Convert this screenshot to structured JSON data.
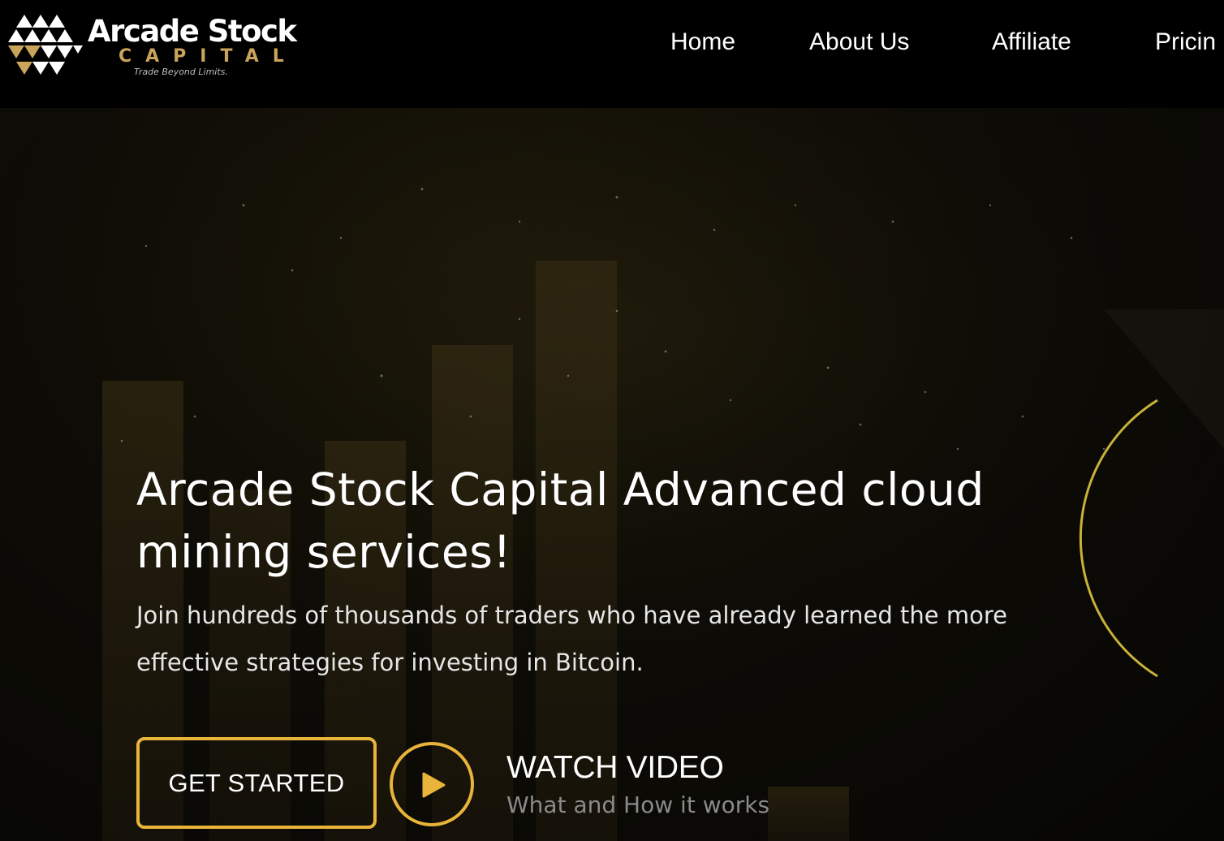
{
  "brand": {
    "name": "Arcade Stock",
    "sub": "CAPITAL",
    "tagline": "Trade Beyond Limits.",
    "accent_color": "#e8b43a",
    "logo_gold": "#c9a45a"
  },
  "nav": {
    "items": [
      {
        "label": "Home"
      },
      {
        "label": "About Us"
      },
      {
        "label": "Affiliate"
      },
      {
        "label": "Pricin"
      }
    ]
  },
  "hero": {
    "title": "Arcade Stock Capital Advanced cloud mining services!",
    "subtitle": "Join hundreds of thousands of traders who have already learned the more effective strategies for investing in Bitcoin.",
    "cta_label": "GET STARTED",
    "video": {
      "icon": "play-icon",
      "title": "WATCH VIDEO",
      "subtitle": "What and How it works"
    }
  }
}
